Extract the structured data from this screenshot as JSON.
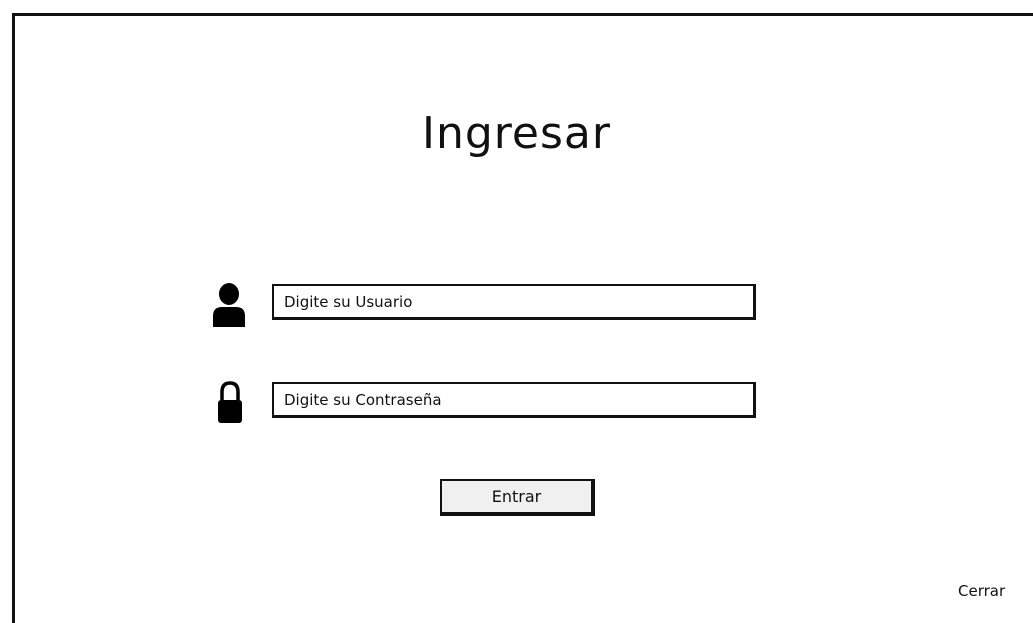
{
  "page": {
    "title": "Ingresar"
  },
  "form": {
    "username": {
      "icon": "user-icon",
      "placeholder": "Digite su Usuario",
      "value": ""
    },
    "password": {
      "icon": "lock-icon",
      "placeholder": "Digite su Contraseña",
      "value": ""
    },
    "submit_label": "Entrar"
  },
  "footer": {
    "close_label": "Cerrar"
  }
}
